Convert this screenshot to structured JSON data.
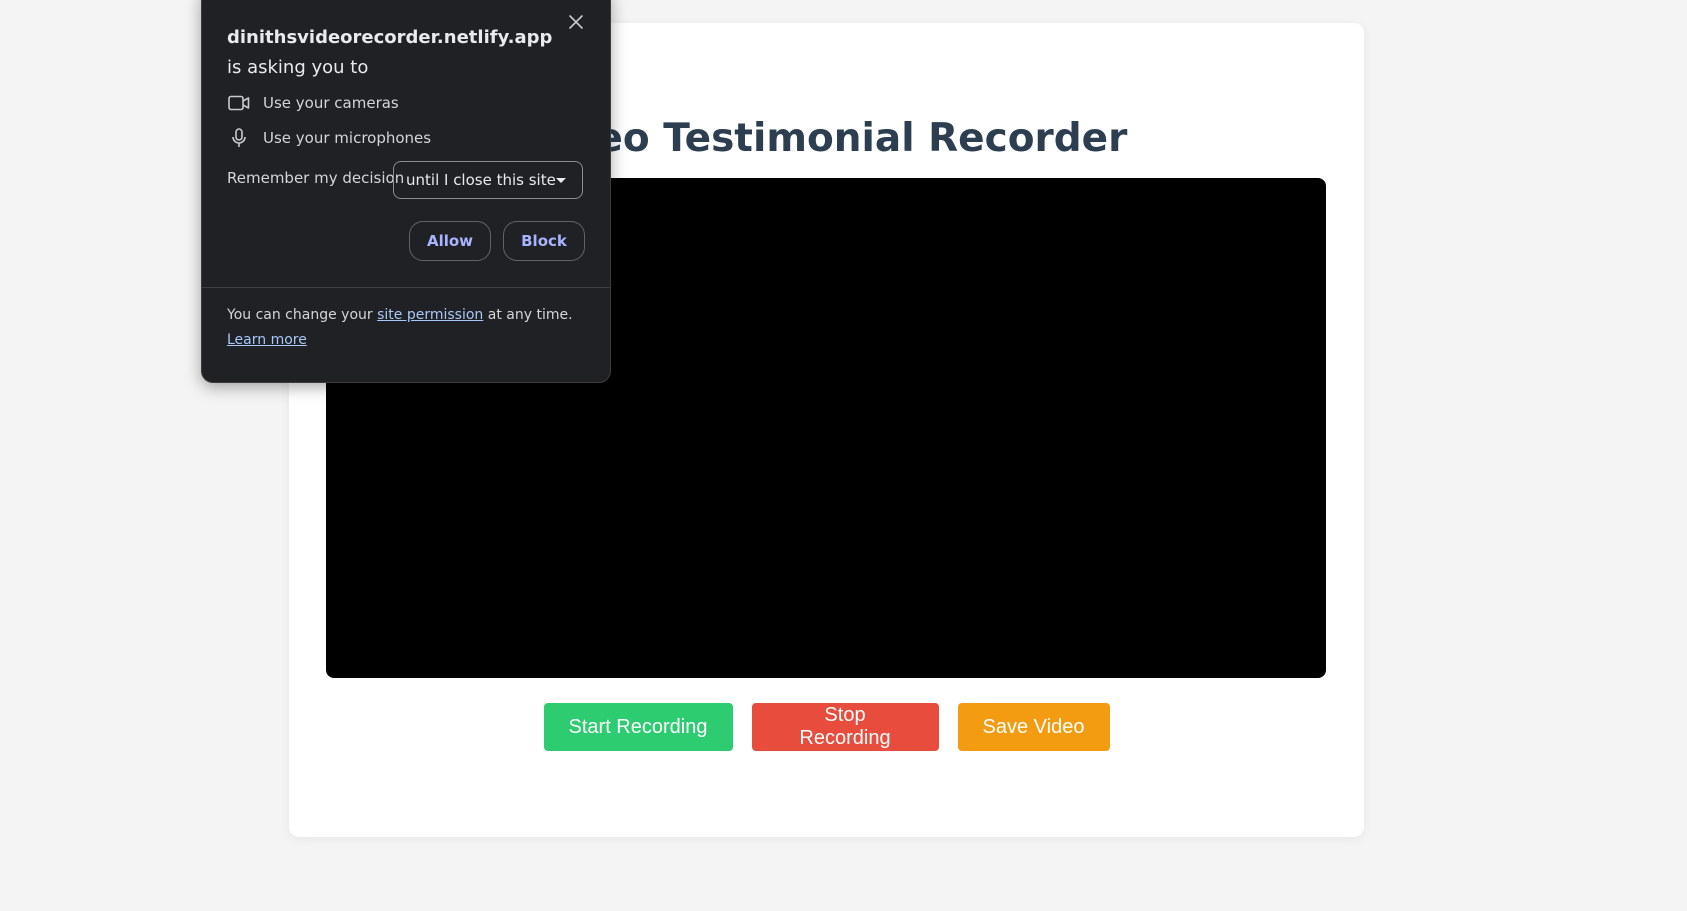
{
  "card": {
    "title": "Video Testimonial Recorder"
  },
  "controls": {
    "start_label": "Start Recording",
    "stop_label": "Stop Recording",
    "save_label": "Save Video"
  },
  "popup": {
    "site": "dinithsvideorecorder.netlify.app",
    "asking": "is asking you to",
    "permissions": {
      "camera": "Use your cameras",
      "microphone": "Use your microphones"
    },
    "remember_label": "Remember my decision",
    "remember_value": "until I close this site",
    "allow_label": "Allow",
    "block_label": "Block",
    "footer_prefix": "You can change your",
    "footer_link": "site permission",
    "footer_suffix": "at any time.",
    "learn_more": "Learn more"
  },
  "colors": {
    "page_bg": "#f4f4f4",
    "title": "#2c3e50",
    "start": "#2ecc71",
    "stop": "#e74c3c",
    "save": "#f39c12",
    "popup_bg": "#202124"
  },
  "icons": [
    "close-icon",
    "camera-icon",
    "microphone-icon",
    "dropdown-caret-icon"
  ]
}
